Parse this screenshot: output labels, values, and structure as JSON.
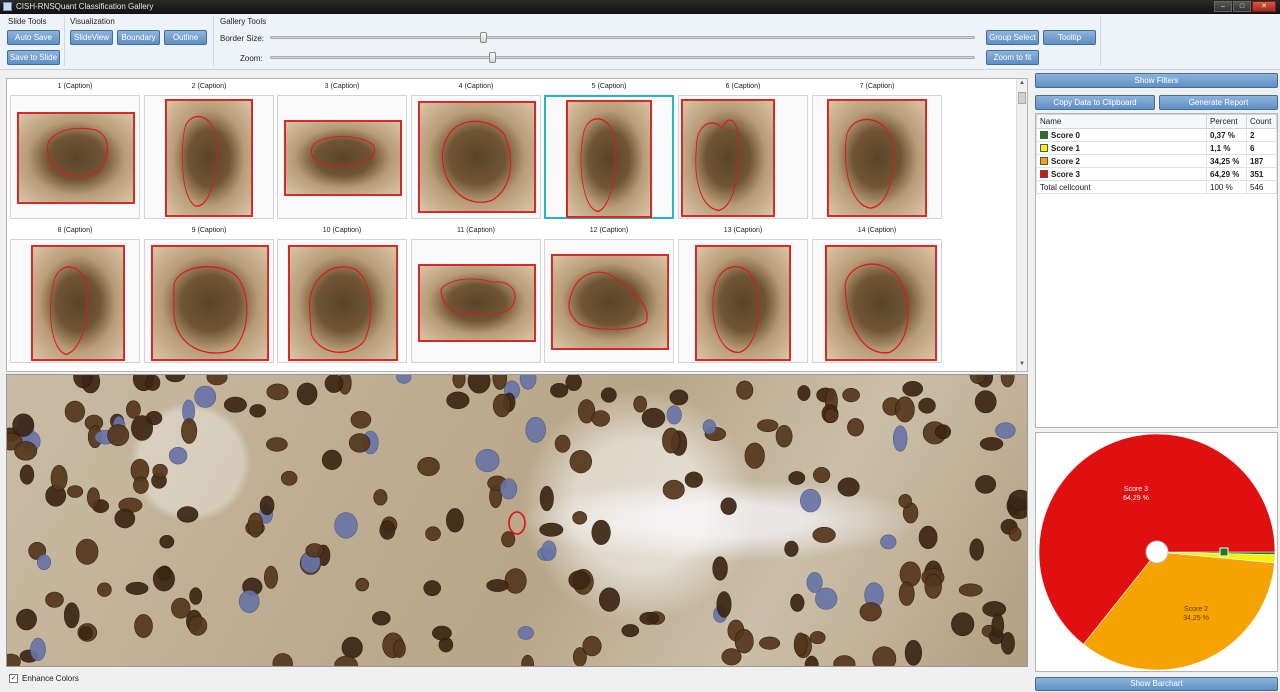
{
  "window": {
    "title": "CISH-RNSQuant Classification Gallery",
    "min": "–",
    "max": "□",
    "close": "✕"
  },
  "toolbar": {
    "slide_tools_label": "Slide Tools",
    "visualization_label": "Visualization",
    "gallery_tools_label": "Gallery Tools",
    "auto_save": "Auto Save",
    "save_to_slide": "Save to Slide",
    "slide_view": "SlideView",
    "boundary": "Boundary",
    "outline": "Outline",
    "border_size_label": "Border Size:",
    "zoom_label": "Zoom:",
    "group_select": "Group Select",
    "tooltip": "Tooltip",
    "zoom_to_fit": "Zoom to fit"
  },
  "gallery": {
    "selected_index": 4,
    "items": [
      {
        "caption": "1 (Caption)"
      },
      {
        "caption": "2 (Caption)"
      },
      {
        "caption": "3 (Caption)"
      },
      {
        "caption": "4 (Caption)"
      },
      {
        "caption": "5 (Caption)"
      },
      {
        "caption": "6 (Caption)"
      },
      {
        "caption": "7 (Caption)"
      },
      {
        "caption": "8 (Caption)"
      },
      {
        "caption": "9 (Caption)"
      },
      {
        "caption": "10 (Caption)"
      },
      {
        "caption": "11 (Caption)"
      },
      {
        "caption": "12 (Caption)"
      },
      {
        "caption": "13 (Caption)"
      },
      {
        "caption": "14 (Caption)"
      }
    ]
  },
  "enhance_colors": {
    "label": "Enhance Colors",
    "checked": true
  },
  "right_panel": {
    "show_filters": "Show Filters",
    "copy_data": "Copy Data to Clipboard",
    "generate_report": "Generate Report",
    "show_barchart": "Show Barchart",
    "columns": {
      "name": "Name",
      "percent": "Percent",
      "count": "Count"
    },
    "rows": [
      {
        "name": "Score 0",
        "percent": "0,37 %",
        "count": "2",
        "color": "#1b7a1b"
      },
      {
        "name": "Score 1",
        "percent": "1,1 %",
        "count": "6",
        "color": "#f2f20a"
      },
      {
        "name": "Score 2",
        "percent": "34,25 %",
        "count": "187",
        "color": "#f5a300"
      },
      {
        "name": "Score 3",
        "percent": "64,29 %",
        "count": "351",
        "color": "#e01010"
      }
    ],
    "total": {
      "name": "Total cellcount",
      "percent": "100 %",
      "count": "546"
    }
  },
  "pie": {
    "score3_name": "Score 3",
    "score3_pct": "64,29 %",
    "score2_name": "Score 2",
    "score2_pct": "34,25 %"
  }
}
